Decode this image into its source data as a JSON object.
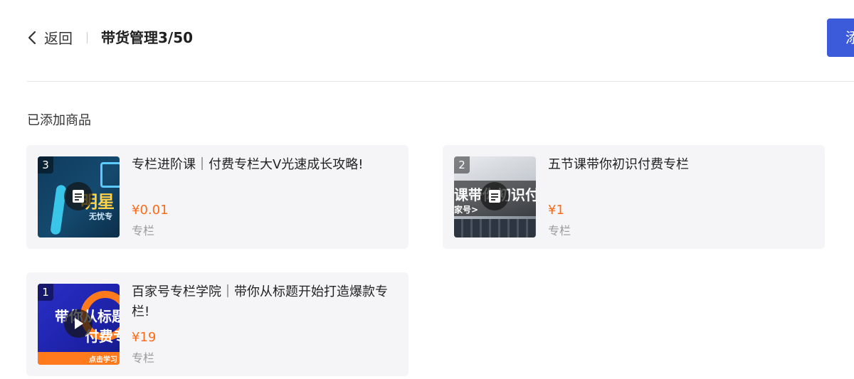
{
  "header": {
    "back_label": "返回",
    "title": "带货管理3/50",
    "add_button_label": "添"
  },
  "section": {
    "title": "已添加商品"
  },
  "products": [
    {
      "index": "3",
      "title": "专栏进阶课｜付费专栏大V光速成长攻略!",
      "price": "¥0.01",
      "category": "专栏",
      "media_type": "article-icon",
      "thumb_text": [
        "明星",
        "无忧专"
      ]
    },
    {
      "index": "2",
      "title": "五节课带你初识付费专栏",
      "price": "¥1",
      "category": "专栏",
      "media_type": "article-icon",
      "thumb_text": [
        "课带你初识付",
        "家号>"
      ]
    },
    {
      "index": "1",
      "title": "百家号专栏学院｜带你从标题开始打造爆款专栏!",
      "price": "¥19",
      "category": "专栏",
      "media_type": "play-icon",
      "thumb_text": [
        "带你从标题",
        "付费专",
        "点击学习"
      ]
    }
  ],
  "colors": {
    "accent": "#3b5bdb",
    "price": "#ff6a1a"
  }
}
